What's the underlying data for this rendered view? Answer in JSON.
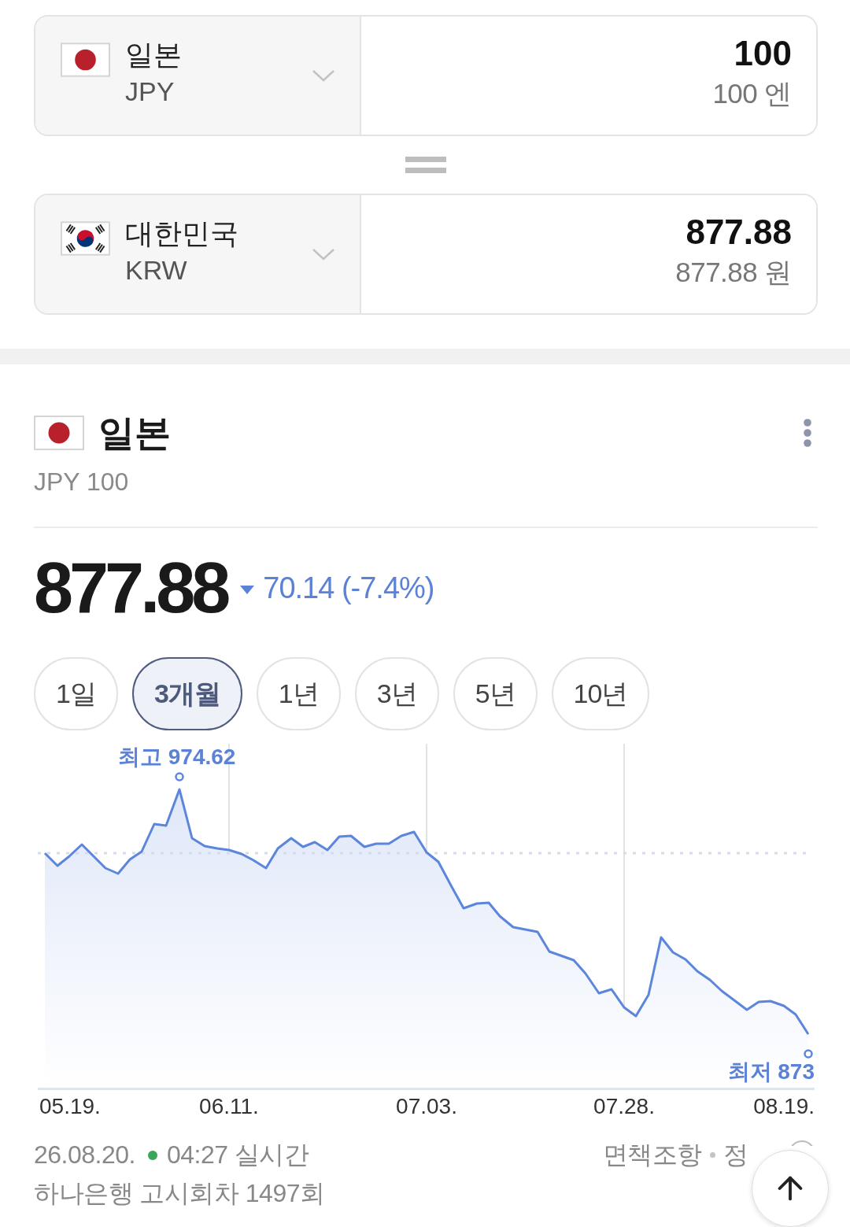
{
  "converter": {
    "rows": [
      {
        "kind": "jp",
        "name": "일본",
        "code": "JPY",
        "value": "100",
        "value_words": "100 엔"
      },
      {
        "kind": "kr",
        "name": "대한민국",
        "code": "KRW",
        "value": "877.88",
        "value_words": "877.88 원"
      }
    ]
  },
  "summary": {
    "kind": "jp",
    "name": "일본",
    "unit": "JPY 100",
    "rate": "877.88",
    "falling": true,
    "change": "70.14 (-7.4%)"
  },
  "periods": [
    {
      "label": "1일",
      "selected": false
    },
    {
      "label": "3개월",
      "selected": true
    },
    {
      "label": "1년",
      "selected": false
    },
    {
      "label": "3년",
      "selected": false
    },
    {
      "label": "5년",
      "selected": false
    },
    {
      "label": "10년",
      "selected": false
    }
  ],
  "chart": {
    "high_label": "최고 974.62",
    "low_label": "최저 873",
    "x_labels": [
      "05.19.",
      "06.11.",
      "07.03.",
      "07.28.",
      "08.19."
    ]
  },
  "footer": {
    "date": "26.08.20.",
    "live": true,
    "time": "04:27 실시간",
    "notice": "하나은행 고시회차 1497회",
    "links": [
      "면책조항",
      "정"
    ]
  }
}
